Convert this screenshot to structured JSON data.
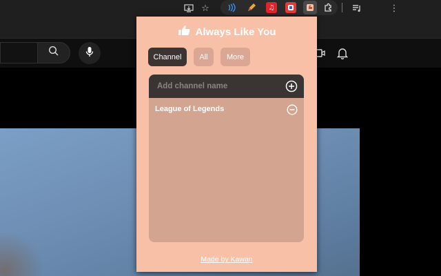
{
  "popup": {
    "title": "Always Like You",
    "tabs": [
      {
        "label": "Channel",
        "active": true
      },
      {
        "label": "All",
        "active": false
      },
      {
        "label": "More",
        "active": false
      }
    ],
    "input": {
      "placeholder": "Add channel name",
      "value": ""
    },
    "channels": [
      {
        "name": "League of Legends"
      }
    ],
    "footer_link": "Made by Kawan"
  },
  "colors": {
    "popup_bg": "#f9c0a8",
    "dark_accent": "#3a3532",
    "list_bg": "#d3a490",
    "tab_inactive": "#dba693"
  },
  "icons": {
    "toolbar": [
      "install-app-icon",
      "bookmark-star-icon",
      "media-playlist-icon",
      "kebab-menu-icon"
    ],
    "extensions": [
      "wifi-signal-ext-icon",
      "pencil-ext-icon",
      "music-ext-icon",
      "red-square-ext-icon",
      "always-like-you-ext-icon",
      "puzzle-extensions-icon"
    ],
    "page_header": [
      "search-icon",
      "microphone-icon",
      "create-video-icon",
      "bell-icon"
    ]
  }
}
